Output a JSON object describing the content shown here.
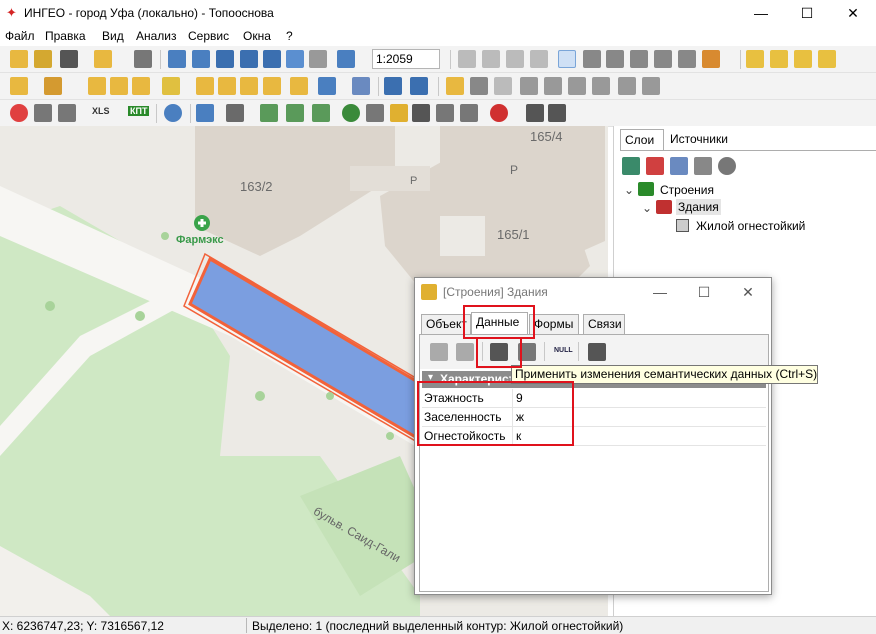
{
  "window": {
    "title": "ИНГЕО - город Уфа (локально) - Топооснова",
    "icon": "ingeo-app-icon",
    "minimize": "—",
    "maximize": "☐",
    "close": "✕"
  },
  "menu": [
    "Файл",
    "Правка",
    "Вид",
    "Анализ",
    "Сервис",
    "Окна",
    "?"
  ],
  "toolbar": {
    "scale_value": "1:2059",
    "xls_label": "XLS",
    "kpt_label": "КПТ",
    "null_label": "NULL"
  },
  "map": {
    "labels": {
      "b163_2": "163/2",
      "b165_4": "165/4",
      "b165_1": "165/1",
      "parking_1": "P",
      "parking_2": "P",
      "pharmacy": "Фармэкс",
      "street": "бульв. Саид-Гали"
    }
  },
  "right_panel": {
    "tabs": [
      "Слои",
      "Источники"
    ],
    "tree": [
      {
        "label": "Строения",
        "icon": "layer-group-icon"
      },
      {
        "label": "Здания",
        "icon": "layer-icon"
      },
      {
        "label": "Жилой огнестойкий",
        "icon": "style-swatch-icon"
      }
    ]
  },
  "dialog": {
    "title": "[Строения] Здания",
    "minimize": "—",
    "maximize": "☐",
    "close": "✕",
    "tabs": [
      "Объект",
      "Данные",
      "Формы",
      "Связи"
    ],
    "active_tab": "Данные",
    "section_header": "Характеристики",
    "properties": [
      {
        "name": "Этажность",
        "value": "9"
      },
      {
        "name": "Заселенность",
        "value": "ж"
      },
      {
        "name": "Огнестойкость",
        "value": "к"
      }
    ]
  },
  "tooltip": "Применить изменения семантических данных (Ctrl+S)",
  "status": {
    "coords": "X: 6236747,23; Y: 7316567,12",
    "selection": "Выделено: 1 (последний выделенный контур: Жилой огнестойкий)"
  },
  "colors": {
    "building_fill": "#7b9ee0",
    "building_outline": "#f2623a",
    "highlight": "#e0121c",
    "park": "#cfe8c4",
    "building": "#dcd5cc"
  }
}
